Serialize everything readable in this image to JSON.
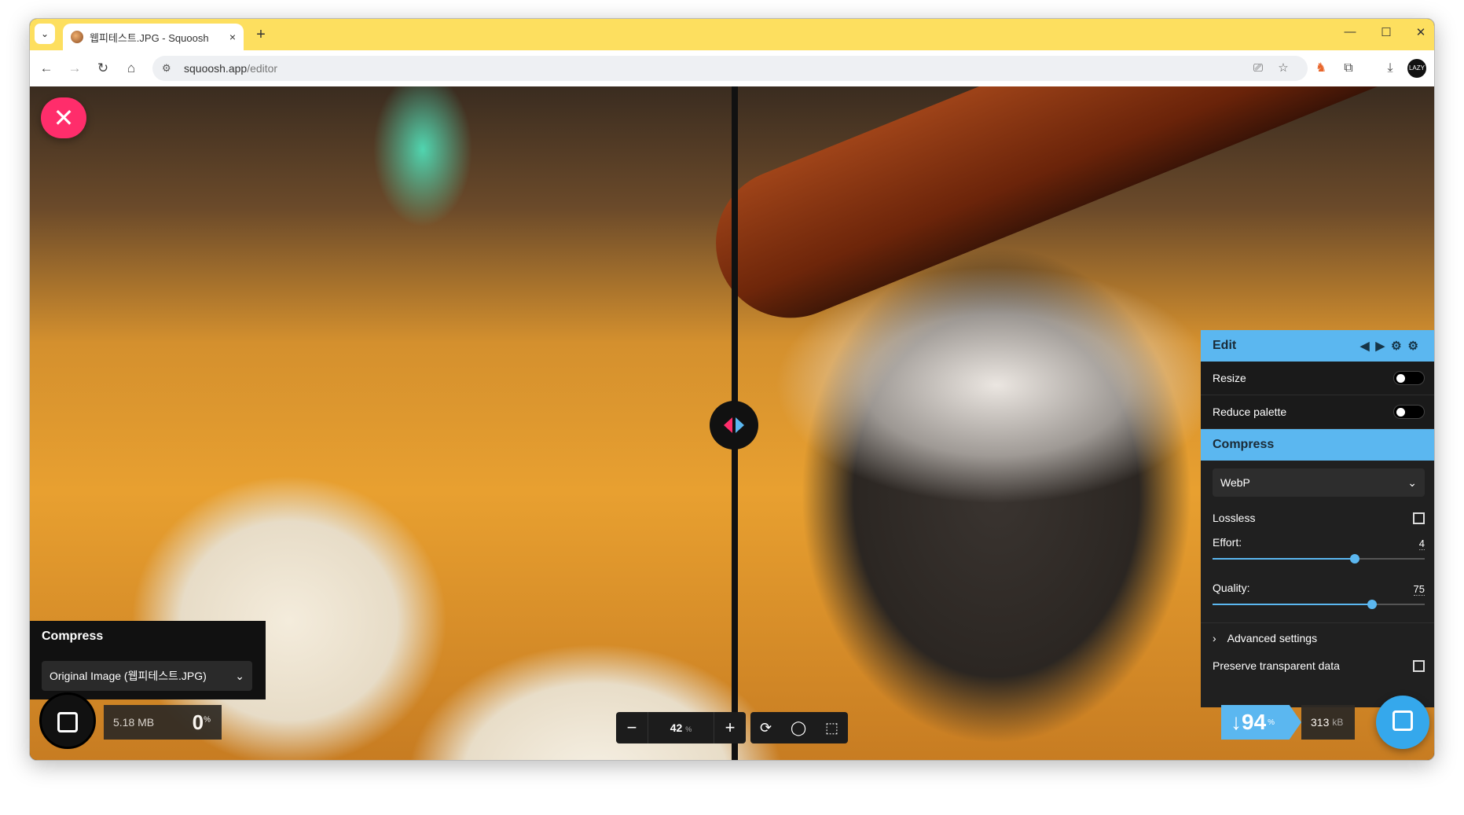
{
  "browser": {
    "tab_title": "웹피테스트.JPG - Squoosh",
    "url_host": "squoosh.app",
    "url_path": "/editor",
    "new_tab": "+",
    "tab_close": "×",
    "profile_label": "LAZY"
  },
  "left": {
    "panel_title": "Compress",
    "select_value": "Original Image (웹피테스트.JPG)",
    "size_value": "5.18",
    "size_unit": "MB",
    "percent": "0",
    "percent_unit": "%"
  },
  "zoom": {
    "value": "42",
    "unit": "%",
    "minus": "−",
    "plus": "+"
  },
  "right": {
    "edit_title": "Edit",
    "resize_label": "Resize",
    "resize_enabled": false,
    "reduce_palette_label": "Reduce palette",
    "reduce_palette_enabled": false,
    "compress_title": "Compress",
    "codec_value": "WebP",
    "lossless_label": "Lossless",
    "lossless_checked": false,
    "effort_label": "Effort:",
    "effort_value": "4",
    "effort_fraction": 0.67,
    "quality_label": "Quality:",
    "quality_value": "75",
    "quality_fraction": 0.75,
    "advanced_label": "Advanced settings",
    "preserve_label": "Preserve transparent data",
    "preserve_checked": false,
    "percent": "94",
    "percent_prefix": "↓",
    "percent_unit": "%",
    "size_value": "313",
    "size_unit": "kB"
  },
  "colors": {
    "accent_blue": "#5bb7f0",
    "accent_pink": "#ff2d6b",
    "tabstrip": "#fddf5f"
  }
}
